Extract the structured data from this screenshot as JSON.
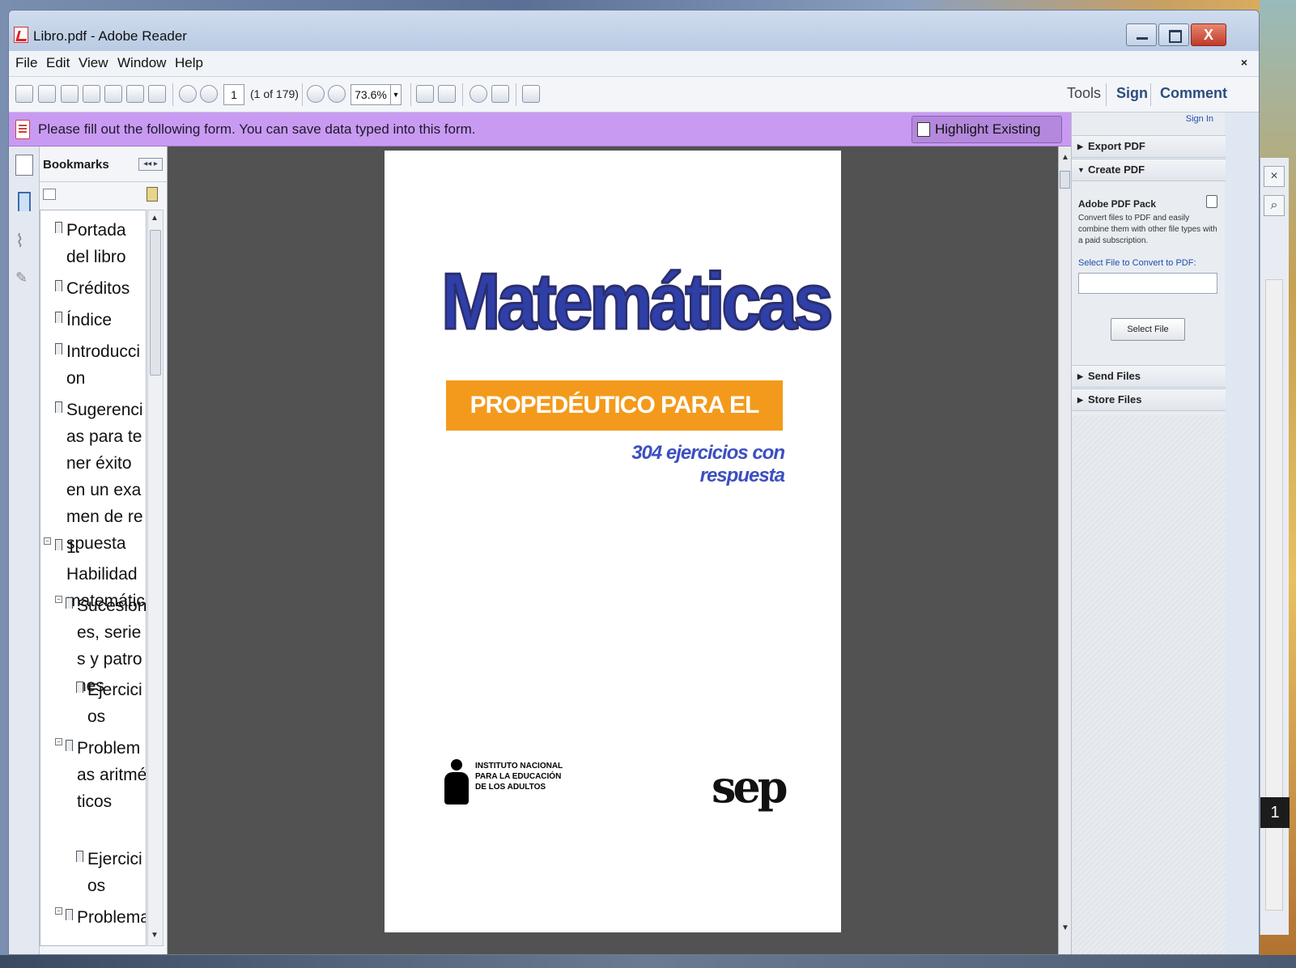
{
  "window": {
    "title": "Libro.pdf - Adobe Reader"
  },
  "menu": {
    "items": [
      "File",
      "Edit",
      "View",
      "Window",
      "Help"
    ],
    "close_glyph": "×"
  },
  "toolbar": {
    "page_number": "1",
    "page_count": "(1 of 179)",
    "zoom": "73.6%",
    "tools": "Tools",
    "sign": "Sign",
    "comment": "Comment"
  },
  "formbar": {
    "message": "Please fill out the following form. You can save data typed into this form.",
    "highlight_button": "Highlight Existing Fields"
  },
  "bookmarks": {
    "title": "Bookmarks",
    "items": [
      {
        "label": "Portada del libro"
      },
      {
        "label": "Créditos"
      },
      {
        "label": "Índice"
      },
      {
        "label": "Introduccion"
      },
      {
        "label": "Sugerencias para tener éxito en un examen de respuesta"
      },
      {
        "label": "1. Habilidad matemática"
      },
      {
        "label": "Sucesiones, series y patrones"
      },
      {
        "label": "Ejercicios"
      },
      {
        "label": "Problemas aritméticos"
      },
      {
        "label": "Ejercicios"
      },
      {
        "label": "Problema"
      }
    ]
  },
  "document": {
    "title": "Matemáticas",
    "band": "PROPEDÉUTICO PARA EL BACHILLERATO",
    "subtitle": "304 ejercicios con respuesta",
    "inea": "INSTITUTO NACIONAL PARA LA EDUCACIÓN DE LOS ADULTOS",
    "sep": "sep"
  },
  "right_pane": {
    "sign_in": "Sign In",
    "export_pdf": "Export PDF",
    "create_pdf": "Create PDF",
    "pack_title": "Adobe PDF Pack",
    "pack_desc": "Convert files to PDF and easily combine them with other file types with a paid subscription.",
    "select_label": "Select File to Convert to PDF:",
    "select_button": "Select File",
    "send_files": "Send Files",
    "store_files": "Store Files"
  },
  "background_window": {
    "page_indicator": "1"
  },
  "colors": {
    "form_bar": "#c99af2",
    "cover_title": "#2f3fa8",
    "cover_band": "#f39a1c",
    "doc_background": "#525252"
  }
}
